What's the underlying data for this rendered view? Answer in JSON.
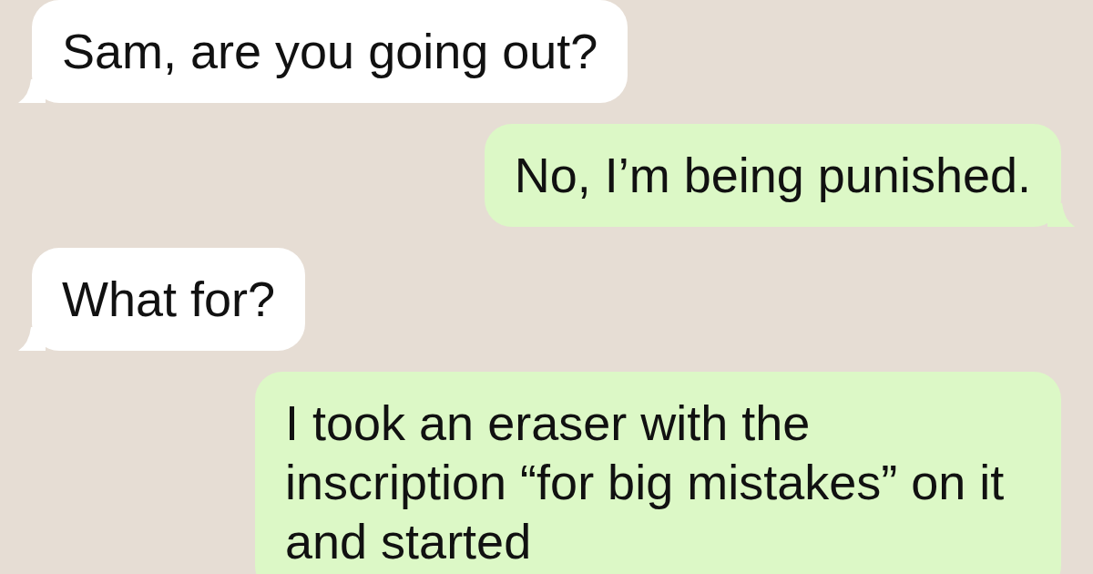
{
  "messages": [
    {
      "kind": "incoming",
      "text": "Sam, are you going out?",
      "tail": true
    },
    {
      "kind": "outgoing",
      "text": "No, I’m being punished.",
      "tail": true
    },
    {
      "kind": "incoming",
      "text": "What for?",
      "tail": true
    },
    {
      "kind": "outgoing",
      "text": "I took an eraser with the inscription “for big mistakes” on it and started",
      "tail": false
    }
  ]
}
